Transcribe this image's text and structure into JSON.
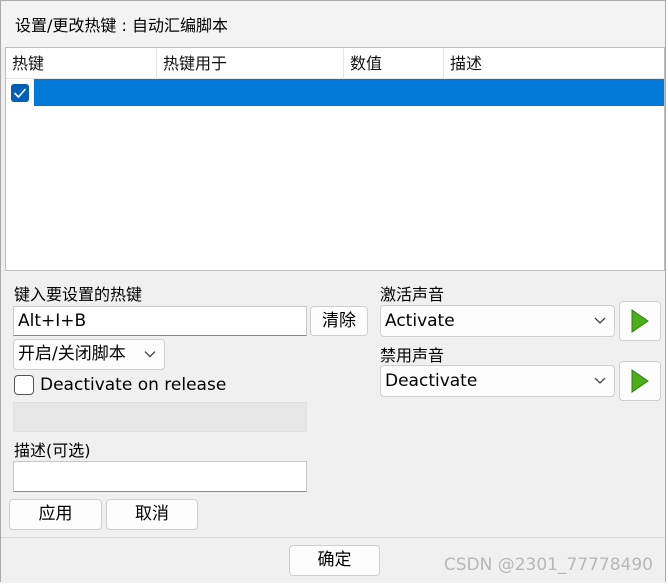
{
  "window": {
    "title": "设置/更改热键 : 自动汇编脚本"
  },
  "listview": {
    "columns": [
      "热键",
      "热键用于",
      "数值",
      "描述"
    ],
    "rows": [
      {
        "checked": true,
        "hotkey": "",
        "used_for": "",
        "value": "",
        "description": ""
      }
    ],
    "selected_row_color": "#0078d7"
  },
  "hotkey_section": {
    "label": "键入要设置的热键",
    "hotkey_value": "Alt+I+B",
    "clear_button": "清除",
    "action_select": "开启/关闭脚本",
    "deactivate_on_release_label": "Deactivate on release",
    "deactivate_on_release_checked": false,
    "description_label": "描述(可选)",
    "description_value": ""
  },
  "sound_section": {
    "activate_label": "激活声音",
    "activate_value": "Activate",
    "deactivate_label": "禁用声音",
    "deactivate_value": "Deactivate",
    "play_icon_color": "#4caf1a"
  },
  "buttons": {
    "apply": "应用",
    "cancel": "取消",
    "ok": "确定"
  },
  "watermark": "CSDN @2301_77778490"
}
